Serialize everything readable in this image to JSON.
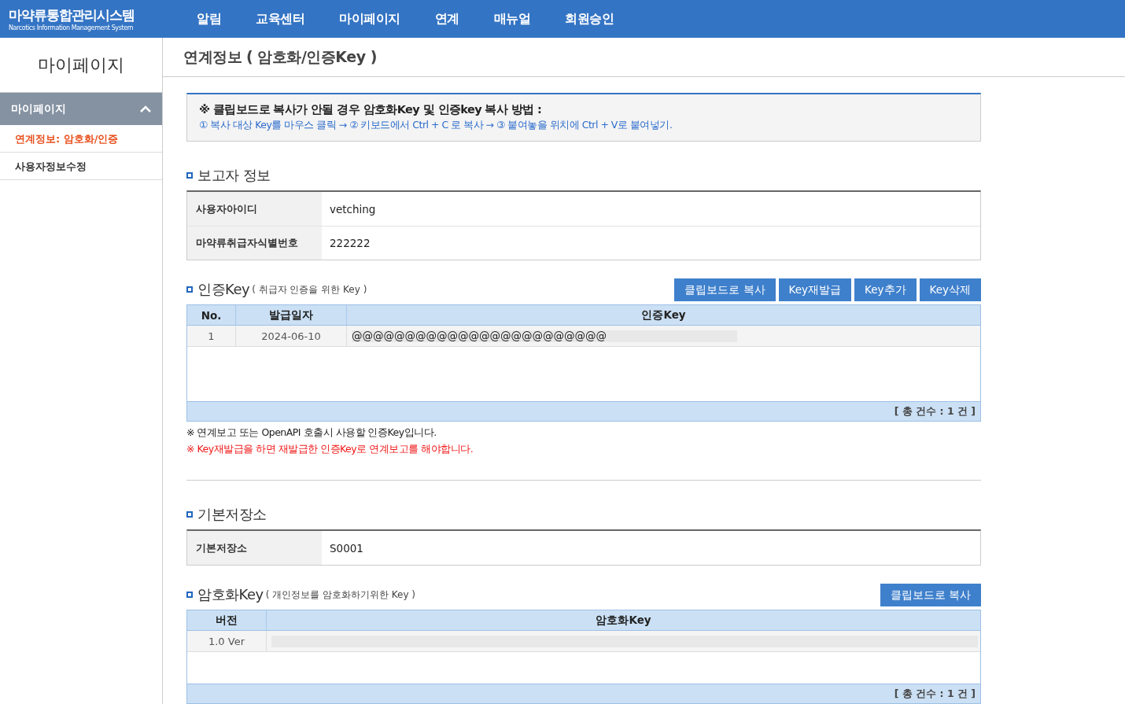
{
  "header": {
    "logo_title": "마약류통합관리시스템",
    "logo_subtitle": "Narcotics Information Management System",
    "nav": [
      "알림",
      "교육센터",
      "마이페이지",
      "연계",
      "매뉴얼",
      "회원승인"
    ]
  },
  "sidebar": {
    "title": "마이페이지",
    "group": {
      "label": "마이페이지",
      "expanded": true,
      "items": [
        {
          "label": "연계정보: 암호화/인증",
          "selected": true
        },
        {
          "label": "사용자정보수정",
          "selected": false
        }
      ]
    }
  },
  "page_title": "연계정보 ( 암호화/인증Key )",
  "notice": {
    "heading": "※ 클립보드로 복사가 안될 경우 암호화Key 및 인증key 복사 방법 :",
    "steps": "① 복사 대상 Key를 마우스 클릭 → ② 키보드에서 Ctrl + C 로 복사 → ③ 붙여놓을 위치에 Ctrl + V로 붙여넣기."
  },
  "reporter": {
    "title": "보고자 정보",
    "rows": [
      {
        "label": "사용자아이디",
        "value": "vetching"
      },
      {
        "label": "마약류취급자식별번호",
        "value": "222222"
      }
    ]
  },
  "auth_key": {
    "title": "인증Key",
    "subtitle": "( 취급자 인증을 위한 Key )",
    "buttons": [
      "클립보드로 복사",
      "Key재발급",
      "Key추가",
      "Key삭제"
    ],
    "columns": [
      "No.",
      "발급일자",
      "인증Key"
    ],
    "rows": [
      {
        "no": "1",
        "date": "2024-06-10",
        "key": "@@@@@@@@@@@@@@@@@@@@@@@@"
      }
    ],
    "total": "[ 총 건수 : 1 건 ]",
    "notes": [
      {
        "text": "※ 연계보고 또는 OpenAPI 호출시 사용할 인증Key입니다.",
        "kind": "info"
      },
      {
        "text": "※ Key재발급을 하면 재발급한 인증Key로 연계보고를 해야합니다.",
        "kind": "warning"
      }
    ]
  },
  "storage": {
    "title": "기본저장소",
    "rows": [
      {
        "label": "기본저장소",
        "value": "S0001"
      }
    ]
  },
  "enc_key": {
    "title": "암호화Key",
    "subtitle": "( 개인정보를 암호화하기위한 Key )",
    "buttons": [
      "클립보드로 복사"
    ],
    "columns": [
      "버전",
      "암호화Key"
    ],
    "rows": [
      {
        "version": "1.0 Ver"
      }
    ],
    "total": "[ 총 건수 : 1 건 ]"
  }
}
